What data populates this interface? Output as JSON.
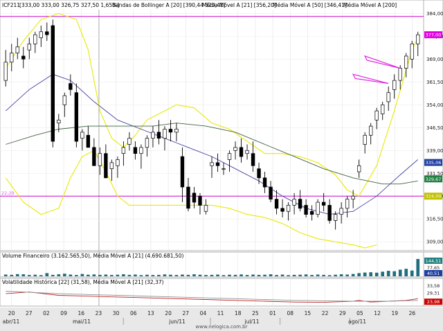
{
  "chart_data": {
    "type": "candlestick",
    "main": {
      "header": {
        "symbol": "ICF211",
        "ohlc": "[333,00   333,00   326,75   327,50   1,65%]",
        "bollinger": "Bandas de Bollinger A [20] [390,44   320,41]",
        "ma21": "Média Móvel A [21] [356,20]",
        "ma50": "Média Móvel A [50] [346,41]",
        "ma200": "Média Móvel A [200]"
      },
      "ylim": [
        307,
        385
      ],
      "y_ticks": [
        "384,00",
        "376,50",
        "369,00",
        "361,50",
        "354,00",
        "346,50",
        "339,00",
        "331,50",
        "324,00",
        "316,50",
        "309,00"
      ],
      "badges": [
        {
          "label": "377,00",
          "value": 377.0,
          "color": "#e000e0"
        },
        {
          "label": "335,06",
          "value": 335.06,
          "color": "#2040a0"
        },
        {
          "label": "329,67",
          "value": 329.67,
          "color": "#208040"
        },
        {
          "label": "324,00",
          "value": 324.0,
          "color": "#c0c000"
        }
      ],
      "hlines": [
        {
          "value": 383.0,
          "color": "#cc00cc"
        },
        {
          "value": 324.0,
          "color": "#cc00cc",
          "label": "22,29"
        }
      ],
      "candles": [
        [
          1,
          362,
          372,
          360,
          368
        ],
        [
          2,
          368,
          374,
          365,
          371
        ],
        [
          3,
          371,
          376,
          369,
          373
        ],
        [
          4,
          370,
          373,
          366,
          369
        ],
        [
          5,
          372,
          376,
          369,
          374
        ],
        [
          6,
          374,
          378,
          371,
          377
        ],
        [
          7,
          376,
          380,
          373,
          378
        ],
        [
          8,
          378,
          381,
          375,
          377
        ],
        [
          9,
          380,
          382,
          340,
          342
        ],
        [
          10,
          348,
          351,
          345,
          349
        ],
        [
          11,
          354,
          358,
          350,
          357
        ],
        [
          12,
          361,
          364,
          357,
          359
        ],
        [
          13,
          358,
          361,
          340,
          342
        ],
        [
          14,
          343,
          346,
          339,
          345
        ],
        [
          15,
          344,
          347,
          341,
          340
        ],
        [
          16,
          340,
          343,
          336,
          334
        ],
        [
          17,
          334,
          340,
          331,
          338
        ],
        [
          18,
          338,
          341,
          330,
          330
        ],
        [
          19,
          333,
          336,
          329,
          335
        ],
        [
          20,
          334,
          337,
          330,
          336
        ],
        [
          21,
          338,
          342,
          334,
          340
        ],
        [
          22,
          341,
          345,
          339,
          343
        ],
        [
          23,
          340,
          342,
          336,
          338
        ],
        [
          24,
          338,
          341,
          333,
          340
        ],
        [
          25,
          340,
          344,
          337,
          343
        ],
        [
          26,
          343,
          347,
          340,
          345
        ],
        [
          27,
          345,
          349,
          341,
          343
        ],
        [
          28,
          343,
          347,
          339,
          346
        ],
        [
          29,
          346,
          349,
          342,
          345
        ],
        [
          30,
          345,
          348,
          342,
          346
        ],
        [
          31,
          337,
          340,
          322,
          327
        ],
        [
          32,
          327,
          330,
          319,
          320
        ],
        [
          33,
          325,
          327,
          320,
          322
        ],
        [
          34,
          324,
          325,
          318,
          321
        ],
        [
          35,
          319,
          323,
          318,
          321
        ],
        [
          36,
          334,
          337,
          330,
          335
        ],
        [
          37,
          335,
          338,
          332,
          334
        ],
        [
          38,
          333,
          335,
          331,
          333
        ],
        [
          39,
          336,
          339,
          332,
          338
        ],
        [
          40,
          339,
          342,
          336,
          340
        ],
        [
          41,
          340,
          343,
          335,
          337
        ],
        [
          42,
          338,
          341,
          336,
          339
        ],
        [
          43,
          338,
          342,
          332,
          334
        ],
        [
          44,
          333,
          335,
          328,
          330
        ],
        [
          45,
          330,
          332,
          325,
          327
        ],
        [
          46,
          327,
          329,
          322,
          323
        ],
        [
          47,
          323,
          326,
          318,
          320
        ],
        [
          48,
          320,
          323,
          317,
          319
        ],
        [
          49,
          319,
          322,
          316,
          321
        ],
        [
          50,
          321,
          325,
          318,
          323
        ],
        [
          51,
          323,
          326,
          319,
          320
        ],
        [
          52,
          321,
          323,
          317,
          318
        ],
        [
          53,
          319,
          321,
          316,
          318
        ],
        [
          54,
          318,
          323,
          317,
          322
        ],
        [
          55,
          322,
          325,
          319,
          321
        ],
        [
          56,
          321,
          323,
          315,
          316
        ],
        [
          57,
          316,
          319,
          313,
          318
        ],
        [
          58,
          318,
          322,
          315,
          320
        ],
        [
          59,
          320,
          324,
          317,
          323
        ],
        [
          60,
          323,
          326,
          320,
          324
        ],
        [
          61,
          332,
          336,
          330,
          334
        ],
        [
          62,
          341,
          345,
          338,
          344
        ],
        [
          63,
          344,
          348,
          341,
          347
        ],
        [
          64,
          349,
          353,
          346,
          352
        ],
        [
          65,
          351,
          355,
          349,
          354
        ],
        [
          66,
          355,
          360,
          352,
          358
        ],
        [
          67,
          359,
          364,
          356,
          362
        ],
        [
          68,
          362,
          367,
          359,
          366
        ],
        [
          69,
          366,
          371,
          363,
          370
        ],
        [
          70,
          369,
          375,
          366,
          374
        ],
        [
          71,
          374,
          378,
          370,
          377
        ]
      ],
      "ma21": [
        [
          1,
          352
        ],
        [
          5,
          359
        ],
        [
          9,
          364
        ],
        [
          12,
          362
        ],
        [
          16,
          355
        ],
        [
          20,
          349
        ],
        [
          24,
          346
        ],
        [
          28,
          343
        ],
        [
          32,
          340
        ],
        [
          36,
          337
        ],
        [
          40,
          333
        ],
        [
          44,
          329
        ],
        [
          48,
          324
        ],
        [
          52,
          320
        ],
        [
          56,
          318
        ],
        [
          60,
          319
        ],
        [
          64,
          324
        ],
        [
          68,
          331
        ],
        [
          71,
          336
        ]
      ],
      "ma50": [
        [
          1,
          341
        ],
        [
          6,
          344
        ],
        [
          10,
          346
        ],
        [
          15,
          347
        ],
        [
          20,
          347
        ],
        [
          26,
          347
        ],
        [
          30,
          348
        ],
        [
          35,
          347
        ],
        [
          40,
          345
        ],
        [
          45,
          341
        ],
        [
          50,
          337
        ],
        [
          55,
          333
        ],
        [
          60,
          330
        ],
        [
          65,
          328
        ],
        [
          68,
          328
        ],
        [
          71,
          329
        ]
      ],
      "boll_upper": [
        [
          1,
          366
        ],
        [
          4,
          375
        ],
        [
          7,
          382
        ],
        [
          10,
          384
        ],
        [
          13,
          382
        ],
        [
          15,
          372
        ],
        [
          17,
          352
        ],
        [
          19,
          343
        ],
        [
          21,
          340
        ],
        [
          23,
          344
        ],
        [
          25,
          349
        ],
        [
          27,
          351
        ],
        [
          30,
          354
        ],
        [
          33,
          353
        ],
        [
          36,
          348
        ],
        [
          39,
          346
        ],
        [
          42,
          342
        ],
        [
          45,
          338
        ],
        [
          48,
          338
        ],
        [
          51,
          337
        ],
        [
          54,
          335
        ],
        [
          57,
          331
        ],
        [
          59,
          326
        ],
        [
          61,
          324
        ],
        [
          64,
          334
        ],
        [
          67,
          352
        ],
        [
          70,
          372
        ],
        [
          71,
          376
        ]
      ],
      "boll_lower": [
        [
          1,
          330
        ],
        [
          4,
          322
        ],
        [
          7,
          318
        ],
        [
          10,
          320
        ],
        [
          12,
          330
        ],
        [
          14,
          337
        ],
        [
          16,
          339
        ],
        [
          18,
          332
        ],
        [
          20,
          324
        ],
        [
          22,
          321
        ],
        [
          24,
          321
        ],
        [
          27,
          321
        ],
        [
          30,
          321
        ],
        [
          33,
          321
        ],
        [
          36,
          321
        ],
        [
          39,
          320
        ],
        [
          42,
          318
        ],
        [
          45,
          317
        ],
        [
          48,
          315
        ],
        [
          51,
          312
        ],
        [
          54,
          310
        ],
        [
          57,
          309
        ],
        [
          60,
          308
        ],
        [
          62,
          307
        ],
        [
          64,
          308
        ]
      ],
      "arrows": [
        [
          62,
          370,
          68,
          366
        ],
        [
          60,
          364,
          66,
          361
        ]
      ]
    },
    "volume": {
      "label": "Volume Financeiro (3.162.565,50), Média Móvel A [21] (4.690.681,50)",
      "badges": [
        {
          "label": "144,51",
          "color": "#208080"
        },
        {
          "label": "77,65",
          "color": "#ffffff"
        },
        {
          "label": "40,51",
          "color": "#2040a0"
        }
      ],
      "values": [
        12,
        10,
        15,
        14,
        9,
        11,
        8,
        22,
        10,
        14,
        18,
        12,
        9,
        16,
        11,
        13,
        10,
        12,
        9,
        11,
        14,
        10,
        12,
        8,
        11,
        9,
        10,
        13,
        11,
        9,
        12,
        10,
        14,
        11,
        9,
        10,
        12,
        8,
        11,
        10,
        13,
        9,
        12,
        10,
        11,
        14,
        9,
        12,
        8,
        10,
        11,
        13,
        9,
        12,
        10,
        8,
        11,
        14,
        12,
        16,
        22,
        26,
        28,
        25,
        32,
        38,
        35,
        46,
        52,
        40,
        120
      ]
    },
    "volatility": {
      "label": "Volatilidade Histórica [22] (31,58), Média Móvel A [21] (32,37)",
      "badges": [
        {
          "label": "33,58",
          "color": "#ffffff"
        },
        {
          "label": "29,31",
          "color": "#ffffff"
        },
        {
          "label": "23,98",
          "color": "#cc0000"
        }
      ],
      "hv": [
        [
          1,
          29
        ],
        [
          5,
          30
        ],
        [
          10,
          28
        ],
        [
          15,
          27.5
        ],
        [
          20,
          27
        ],
        [
          25,
          26.5
        ],
        [
          30,
          26
        ],
        [
          35,
          25.5
        ],
        [
          40,
          25
        ],
        [
          45,
          24.5
        ],
        [
          50,
          24
        ],
        [
          55,
          23.8
        ],
        [
          60,
          24.5
        ],
        [
          61,
          25
        ],
        [
          63,
          24
        ],
        [
          66,
          24.5
        ],
        [
          69,
          25
        ],
        [
          71,
          26
        ]
      ],
      "hv_ma": [
        [
          1,
          30.5
        ],
        [
          10,
          29
        ],
        [
          20,
          28
        ],
        [
          30,
          27
        ],
        [
          40,
          26
        ],
        [
          50,
          25
        ],
        [
          60,
          24.5
        ],
        [
          66,
          24.5
        ],
        [
          71,
          25
        ]
      ]
    },
    "x_ticks": [
      "20",
      "27",
      "02",
      "09",
      "16",
      "23",
      "30",
      "06",
      "13",
      "20",
      "27",
      "04",
      "11",
      "18",
      "25",
      "01",
      "08",
      "15",
      "22",
      "29",
      "05",
      "12",
      "19",
      "26"
    ],
    "months": [
      "abr/11",
      "mai/11",
      "jun/11",
      "jul/11",
      "ago/11"
    ],
    "footer": "www.nelogica.com.br"
  }
}
